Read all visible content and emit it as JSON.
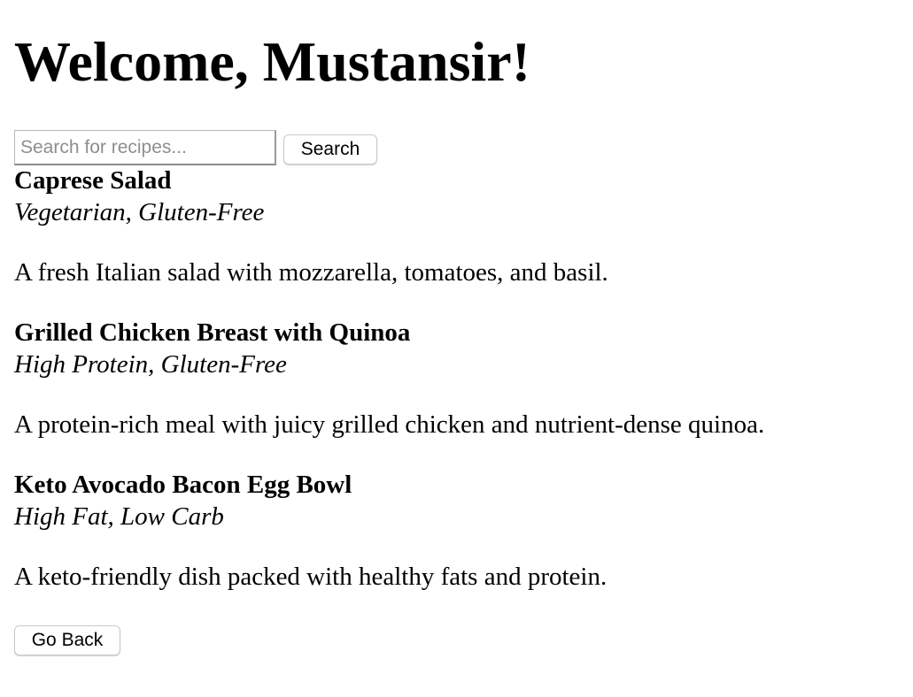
{
  "header": {
    "title": "Welcome, Mustansir!"
  },
  "search": {
    "placeholder": "Search for recipes...",
    "value": "",
    "button_label": "Search"
  },
  "recipes": [
    {
      "name": "Caprese Salad",
      "tags": "Vegetarian, Gluten-Free",
      "description": "A fresh Italian salad with mozzarella, tomatoes, and basil."
    },
    {
      "name": "Grilled Chicken Breast with Quinoa",
      "tags": "High Protein, Gluten-Free",
      "description": "A protein-rich meal with juicy grilled chicken and nutrient-dense quinoa."
    },
    {
      "name": "Keto Avocado Bacon Egg Bowl",
      "tags": "High Fat, Low Carb",
      "description": "A keto-friendly dish packed with healthy fats and protein."
    }
  ],
  "footer": {
    "back_label": "Go Back"
  }
}
